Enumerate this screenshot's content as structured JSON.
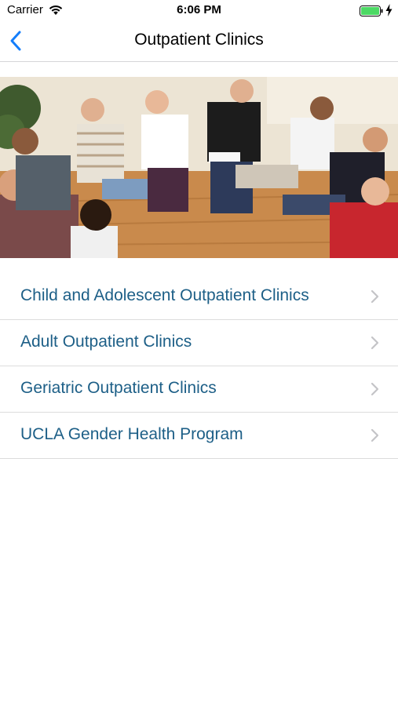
{
  "status_bar": {
    "carrier": "Carrier",
    "time": "6:06 PM",
    "battery_color": "#4cd964",
    "icons": [
      "wifi-icon",
      "battery-icon",
      "charging-bolt-icon"
    ]
  },
  "nav": {
    "title": "Outpatient Clinics",
    "back_icon": "chevron-left-icon",
    "accent_color": "#147efb"
  },
  "hero": {
    "image": "group-therapy-circle-photo"
  },
  "clinics": [
    {
      "label": "Child and Adolescent Outpatient Clinics"
    },
    {
      "label": "Adult Outpatient Clinics"
    },
    {
      "label": "Geriatric Outpatient Clinics"
    },
    {
      "label": "UCLA Gender Health Program"
    }
  ],
  "list_text_color": "#1d5f87"
}
